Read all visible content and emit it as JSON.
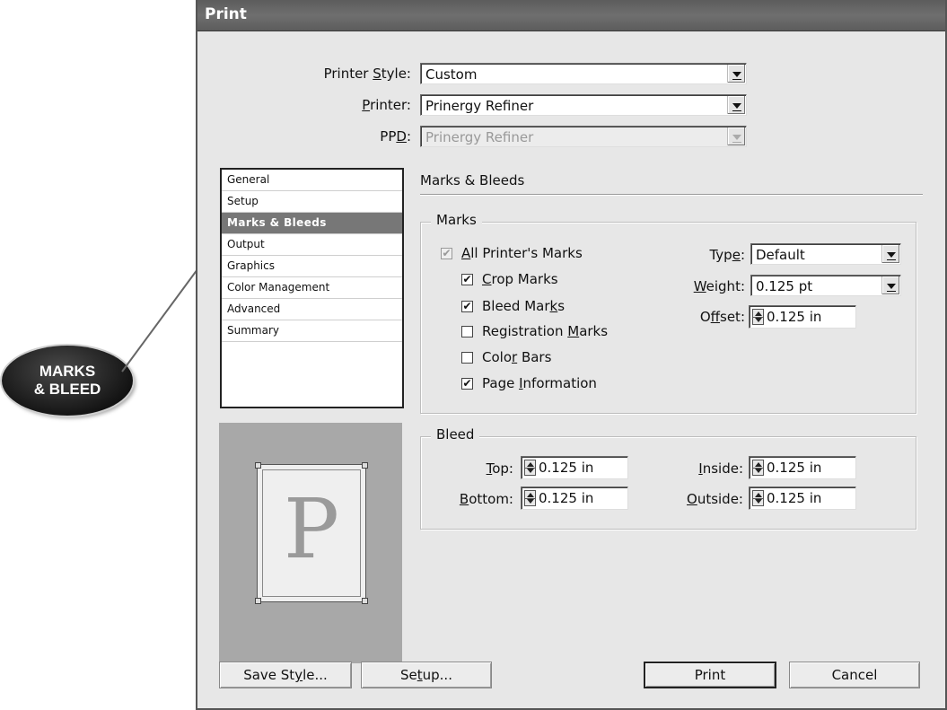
{
  "window": {
    "title": "Print"
  },
  "top": {
    "printer_style": {
      "label_pre": "Printer ",
      "label_u": "S",
      "label_post": "tyle:",
      "value": "Custom"
    },
    "printer": {
      "label_pre": "",
      "label_u": "P",
      "label_post": "rinter:",
      "value": "Prinergy Refiner"
    },
    "ppd": {
      "label_pre": "PP",
      "label_u": "D",
      "label_post": ":",
      "value": "Prinergy Refiner"
    }
  },
  "categories": [
    "General",
    "Setup",
    "Marks & Bleeds",
    "Output",
    "Graphics",
    "Color Management",
    "Advanced",
    "Summary"
  ],
  "selected_category": "Marks & Bleeds",
  "section_title": "Marks & Bleeds",
  "marks": {
    "group_title": "Marks",
    "all_marks": {
      "pre": "",
      "u": "A",
      "post": "ll Printer's Marks",
      "checked": true
    },
    "crop": {
      "pre": "",
      "u": "C",
      "post": "rop Marks",
      "checked": true
    },
    "bleed_marks": {
      "pre": "Bleed Mar",
      "u": "k",
      "post": "s",
      "checked": true
    },
    "registration": {
      "pre": "Registration ",
      "u": "M",
      "post": "arks",
      "checked": false
    },
    "color_bars": {
      "pre": "Colo",
      "u": "r",
      "post": " Bars",
      "checked": false
    },
    "page_info": {
      "pre": "Page ",
      "u": "I",
      "post": "nformation",
      "checked": true
    },
    "type": {
      "pre": "Typ",
      "u": "e",
      "post": ":",
      "value": "Default"
    },
    "weight": {
      "pre": "",
      "u": "W",
      "post": "eight:",
      "value": "0.125 pt"
    },
    "offset": {
      "pre": "O",
      "u": "f",
      "post": "fset:",
      "value": "0.125 in"
    }
  },
  "bleed": {
    "group_title": "Bleed",
    "top": {
      "pre": "",
      "u": "T",
      "post": "op:",
      "value": "0.125 in"
    },
    "bottom": {
      "pre": "",
      "u": "B",
      "post": "ottom:",
      "value": "0.125 in"
    },
    "inside": {
      "pre": "",
      "u": "I",
      "post": "nside:",
      "value": "0.125 in"
    },
    "outside": {
      "pre": "",
      "u": "O",
      "post": "utside:",
      "value": "0.125 in"
    }
  },
  "preview": {
    "letter": "P"
  },
  "buttons": {
    "save_style": {
      "pre": "Save St",
      "u": "y",
      "post": "le..."
    },
    "setup": {
      "pre": "Se",
      "u": "t",
      "post": "up..."
    },
    "print": "Print",
    "cancel": "Cancel"
  },
  "callout": {
    "line1": "MARKS",
    "line2": "& BLEED"
  },
  "checkmark": "✔"
}
